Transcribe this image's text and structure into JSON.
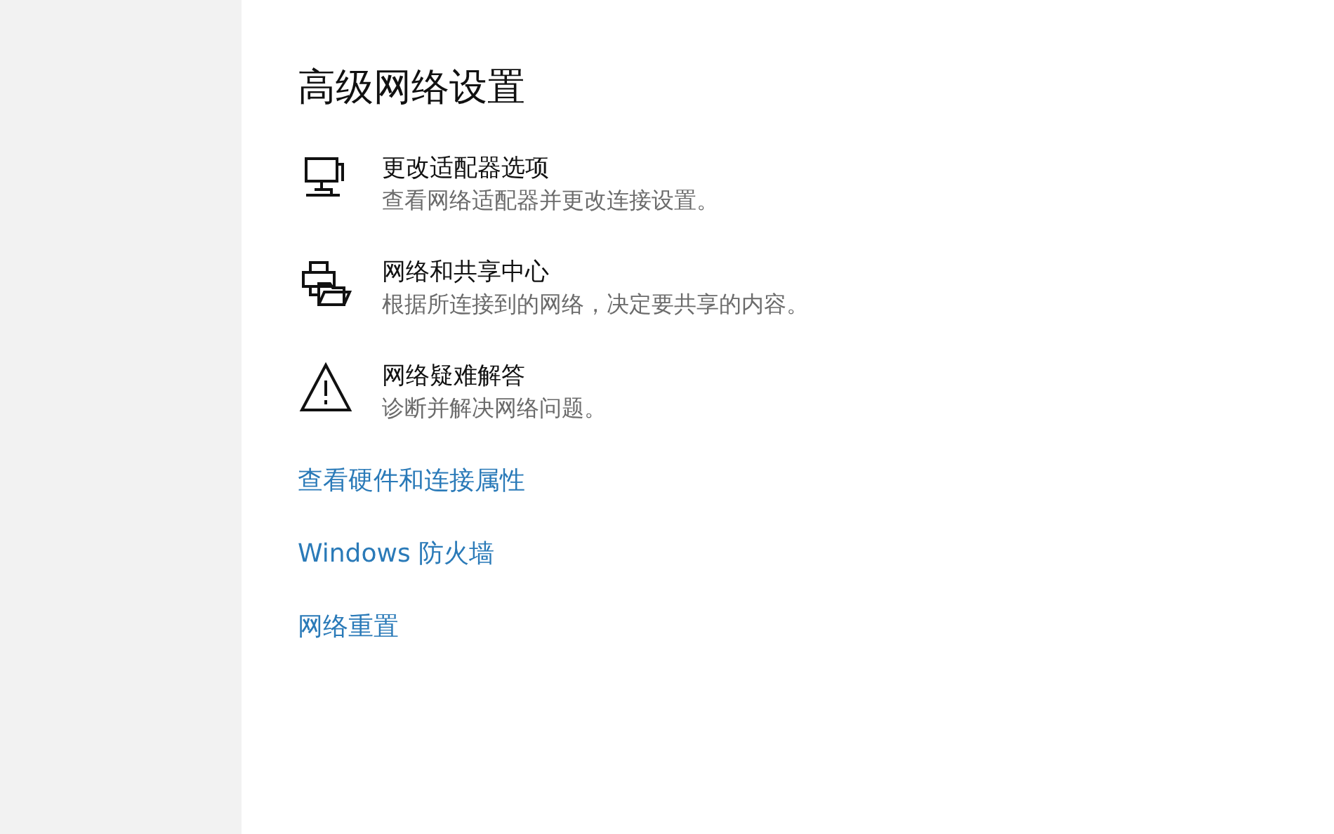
{
  "title": "高级网络设置",
  "options": [
    {
      "kind": "adapter",
      "title": "更改适配器选项",
      "description": "查看网络适配器并更改连接设置。"
    },
    {
      "kind": "sharing",
      "title": "网络和共享中心",
      "description": "根据所连接到的网络，决定要共享的内容。"
    },
    {
      "kind": "troubleshoot",
      "title": "网络疑难解答",
      "description": "诊断并解决网络问题。"
    }
  ],
  "links": [
    "查看硬件和连接属性",
    "Windows 防火墙",
    "网络重置"
  ]
}
